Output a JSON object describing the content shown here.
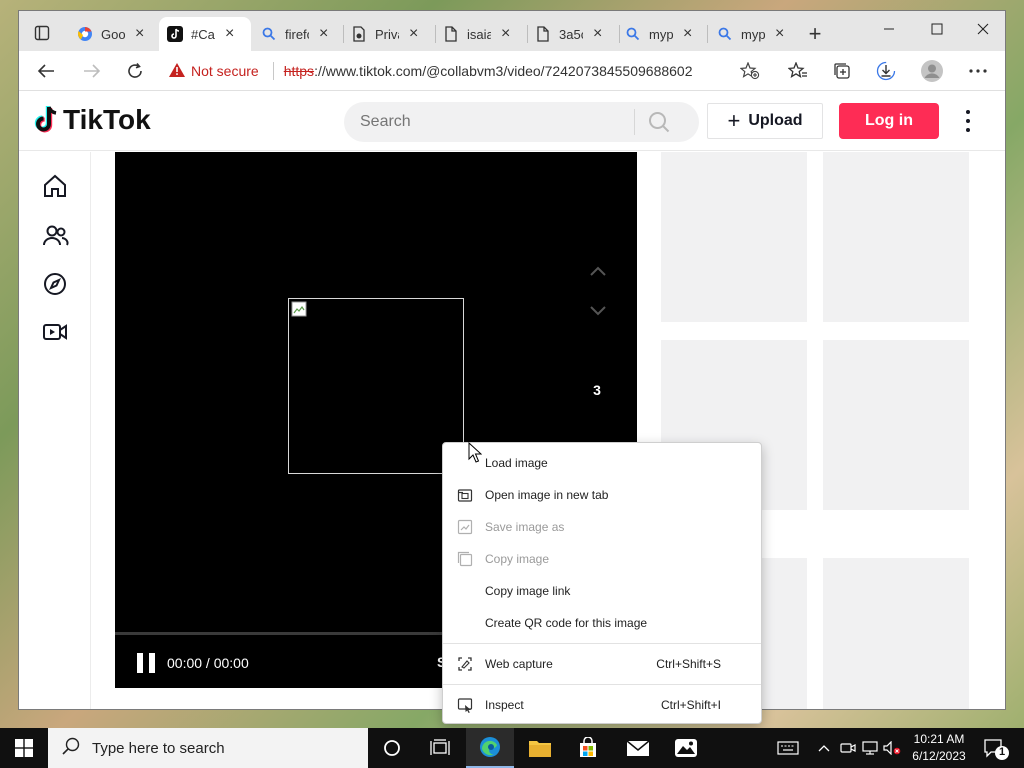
{
  "browser": {
    "tabs": [
      {
        "title": "Goo",
        "icon": "google-icon"
      },
      {
        "title": "#Cap",
        "icon": "tiktok-icon",
        "active": true
      },
      {
        "title": "firefo",
        "icon": "search-icon"
      },
      {
        "title": "Priva",
        "icon": "private-icon"
      },
      {
        "title": "isaia",
        "icon": "document-icon"
      },
      {
        "title": "3a5c",
        "icon": "document-icon"
      },
      {
        "title": "myp",
        "icon": "search-icon"
      },
      {
        "title": "myp",
        "icon": "search-icon"
      }
    ],
    "new_tab": "+",
    "address": {
      "warning": "Not secure",
      "scheme": "https",
      "rest": "://www.tiktok.com/@collabvm3/video/7242073845509688602"
    }
  },
  "tiktok": {
    "logo": "TikTok",
    "search_placeholder": "Search",
    "upload_label": "Upload",
    "login_label": "Log in",
    "brand_color": "#fe2c55",
    "nav_icons": [
      "home-icon",
      "following-icon",
      "explore-icon",
      "live-icon"
    ],
    "video": {
      "count": "3",
      "time": "00:00 / 00:00",
      "partial_text": "S"
    }
  },
  "context_menu": {
    "items": [
      {
        "label": "Load image",
        "shortcut": "",
        "enabled": true
      },
      {
        "label": "Open image in new tab",
        "shortcut": "",
        "enabled": true
      },
      {
        "label": "Save image as",
        "shortcut": "",
        "enabled": false
      },
      {
        "label": "Copy image",
        "shortcut": "",
        "enabled": false
      },
      {
        "label": "Copy image link",
        "shortcut": "",
        "enabled": true
      },
      {
        "label": "Create QR code for this image",
        "shortcut": "",
        "enabled": true
      },
      {
        "label": "Web capture",
        "shortcut": "Ctrl+Shift+S",
        "enabled": true
      },
      {
        "label": "Inspect",
        "shortcut": "Ctrl+Shift+I",
        "enabled": true
      }
    ]
  },
  "taskbar": {
    "search_placeholder": "Type here to search",
    "time": "10:21 AM",
    "date": "6/12/2023",
    "notification_count": "1"
  }
}
